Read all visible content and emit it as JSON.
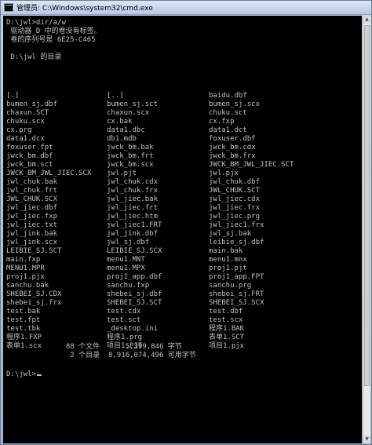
{
  "window": {
    "title": "管理员: C:\\Windows\\system32\\cmd.exe"
  },
  "console": {
    "command": "D:\\jwl>dir/a/w",
    "volume_label": " 驱动器 D 中的卷没有标签。",
    "serial": " 卷的序列号是 6E25-C465",
    "dir_header": " D:\\jwl 的目录",
    "rows": [
      [
        "[.]",
        "[..]",
        "baidu.dbf"
      ],
      [
        "bumen_sj.dbf",
        "bumen_sj.sct",
        "bumen_sj.scx"
      ],
      [
        "chaxun.SCT",
        "chaxun.scx",
        "chuku.sct"
      ],
      [
        "chuku.scx",
        "cx.bak",
        "cx.fxp"
      ],
      [
        "cx.prg",
        "data1.dbc",
        "data1.dct"
      ],
      [
        "data1.dcx",
        "db1.mdb",
        "foxuser.dbf"
      ],
      [
        "foxuser.fpt",
        "jwck_bm.bak",
        "jwck_bm.cdx"
      ],
      [
        "jwck_bm.dbf",
        "jwck_bm.frt",
        "jwck_bm.frx"
      ],
      [
        "jwck_bm.sct",
        "jwck_bm.scx",
        "JWCK_BM_JWL_JIEC.SCT"
      ],
      [
        "JWCK_BM_JWL_JIEC.SCX",
        "jwl.pjt",
        "jwl.pjx"
      ],
      [
        "jwl_chuk.bak",
        "jwl_chuk.cdx",
        "jwl_chuk.dbf"
      ],
      [
        "jwl_chuk.frt",
        "jwl_chuk.frx",
        "JWL_CHUK.SCT"
      ],
      [
        "JWL_CHUK.SCX",
        "jwl_jiec.bak",
        "jwl_jiec.cdx"
      ],
      [
        "jwl_jiec.dbf",
        "jwl_jiec.frt",
        "jwl_jiec.frx"
      ],
      [
        "jwl_jiec.fxp",
        "jwl_jiec.htm",
        "jwl_jiec.prg"
      ],
      [
        "jwl_jiec.txt",
        "jwl_jiec1.FRT",
        "jwl_jiec1.frx"
      ],
      [
        "jwl_jink.bak",
        "jwl_jink.dbf",
        "jwl_sj.bak"
      ],
      [
        "jwl_jink.scx",
        "jwl_sj.dbf",
        "leibie_sj.dbf"
      ],
      [
        "LEIBIE_SJ.SCT",
        "LEIBIE_SJ.SCX",
        "main.bak"
      ],
      [
        "main.fxp",
        "menu1.MNT",
        "menu1.mnx"
      ],
      [
        "MENU1.MPR",
        "menu1.MPX",
        "proj1.pjt"
      ],
      [
        "proj1.pjx",
        "proj1_app.dbf",
        "proj1_app.FPT"
      ],
      [
        "sanchu.bak",
        "sanchu.fxp",
        "sanchu.prg"
      ],
      [
        "SHEBEI_SJ.CDX",
        "shebei_sj.dbf",
        "shebei_sj.FRT"
      ],
      [
        "shebei_sj.frx",
        "SHEBEI_SJ.SCT",
        "SHEBEI_SJ.SCX"
      ],
      [
        "test.bak",
        "test.cdx",
        "test.dbf"
      ],
      [
        "test.fpt",
        "test.sct",
        "test.scx"
      ],
      [
        "test.tbk",
        "_desktop.ini",
        "程序1.BAK"
      ],
      [
        "程序1.FXP",
        "程序1.prg",
        "表单1.SCT"
      ],
      [
        "表单1.scx",
        "项目1.PJT",
        "项目1.pjx"
      ]
    ],
    "file_summary": "              88 个文件      5,399,846 字节",
    "dir_summary": "               2 个目录  8,916,074,496 可用字节",
    "prompt": "D:\\jwl>"
  }
}
